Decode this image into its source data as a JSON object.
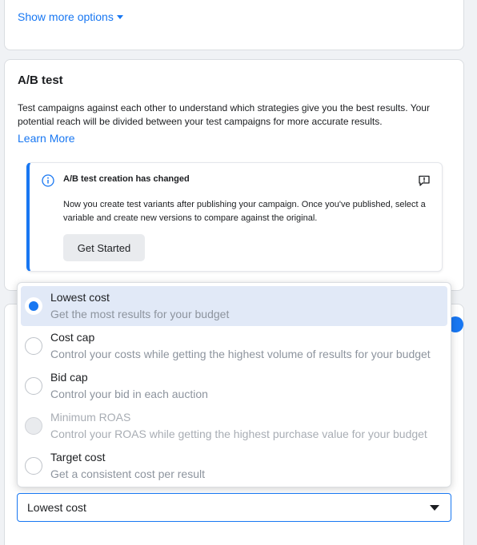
{
  "top_card": {
    "show_more_label": "Show more options"
  },
  "ab_test": {
    "title": "A/B test",
    "description": "Test campaigns against each other to understand which strategies give you the best results. Your potential reach will be divided between your test campaigns for more accurate results.",
    "learn_more": "Learn More",
    "notice": {
      "title": "A/B test creation has changed",
      "body": "Now you create test variants after publishing your campaign. Once you've published, select a variable and create new versions to compare against the original.",
      "button_label": "Get Started"
    }
  },
  "bid_strategy": {
    "options": [
      {
        "title": "Lowest cost",
        "subtitle": "Get the most results for your budget",
        "selected": true,
        "disabled": false
      },
      {
        "title": "Cost cap",
        "subtitle": "Control your costs while getting the highest volume of results for your budget",
        "selected": false,
        "disabled": false
      },
      {
        "title": "Bid cap",
        "subtitle": "Control your bid in each auction",
        "selected": false,
        "disabled": false
      },
      {
        "title": "Minimum ROAS",
        "subtitle": "Control your ROAS while getting the highest purchase value for your budget",
        "selected": false,
        "disabled": true
      },
      {
        "title": "Target cost",
        "subtitle": "Get a consistent cost per result",
        "selected": false,
        "disabled": false
      }
    ],
    "selected_value": "Lowest cost"
  },
  "colors": {
    "accent": "#1877f2",
    "selected_row": "#e1e9f7"
  },
  "icons": {
    "info": "info-icon",
    "feedback": "feedback-icon",
    "caret": "chevron-down-icon"
  }
}
